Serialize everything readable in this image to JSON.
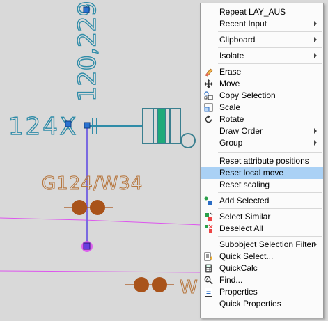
{
  "colors": {
    "background": "#d9d9d9",
    "dimension": "#2f8ca8",
    "symbol": "#3a7f8f",
    "symbol_fill": "#1faa7a",
    "orange_text": "#b7773f",
    "circles": "#a9531a",
    "magenta": "#dd55ee",
    "selected_line": "#7a6ae0",
    "grip": "#2a72d0",
    "menu_highlight": "#aad1f5"
  },
  "drawing": {
    "dimension_value": "120,229",
    "tag_124x": "124X",
    "label_g124": "G124/W34",
    "label_w": "W"
  },
  "context_menu": {
    "items": [
      {
        "label": "Repeat LAY_AUS",
        "submenu": false,
        "icon": ""
      },
      {
        "label": "Recent Input",
        "submenu": true,
        "icon": ""
      },
      {
        "label": "Clipboard",
        "submenu": true,
        "icon": ""
      },
      {
        "label": "Isolate",
        "submenu": true,
        "icon": ""
      },
      {
        "label": "Erase",
        "submenu": false,
        "icon": "eraser-icon"
      },
      {
        "label": "Move",
        "submenu": false,
        "icon": "move-icon"
      },
      {
        "label": "Copy Selection",
        "submenu": false,
        "icon": "copy-icon"
      },
      {
        "label": "Scale",
        "submenu": false,
        "icon": "scale-icon"
      },
      {
        "label": "Rotate",
        "submenu": false,
        "icon": "rotate-icon"
      },
      {
        "label": "Draw Order",
        "submenu": true,
        "icon": ""
      },
      {
        "label": "Group",
        "submenu": true,
        "icon": ""
      },
      {
        "label": "Reset attribute positions",
        "submenu": false,
        "icon": ""
      },
      {
        "label": "Reset local move",
        "submenu": false,
        "icon": "",
        "highlighted": true
      },
      {
        "label": "Reset scaling",
        "submenu": false,
        "icon": ""
      },
      {
        "label": "Add Selected",
        "submenu": false,
        "icon": "add-selected-icon"
      },
      {
        "label": "Select Similar",
        "submenu": false,
        "icon": "select-similar-icon"
      },
      {
        "label": "Deselect All",
        "submenu": false,
        "icon": "deselect-all-icon"
      },
      {
        "label": "Subobject Selection Filter",
        "submenu": true,
        "icon": ""
      },
      {
        "label": "Quick Select...",
        "submenu": false,
        "icon": "quick-select-icon"
      },
      {
        "label": "QuickCalc",
        "submenu": false,
        "icon": "calculator-icon"
      },
      {
        "label": "Find...",
        "submenu": false,
        "icon": "find-icon"
      },
      {
        "label": "Properties",
        "submenu": false,
        "icon": "properties-icon"
      },
      {
        "label": "Quick Properties",
        "submenu": false,
        "icon": ""
      }
    ]
  }
}
